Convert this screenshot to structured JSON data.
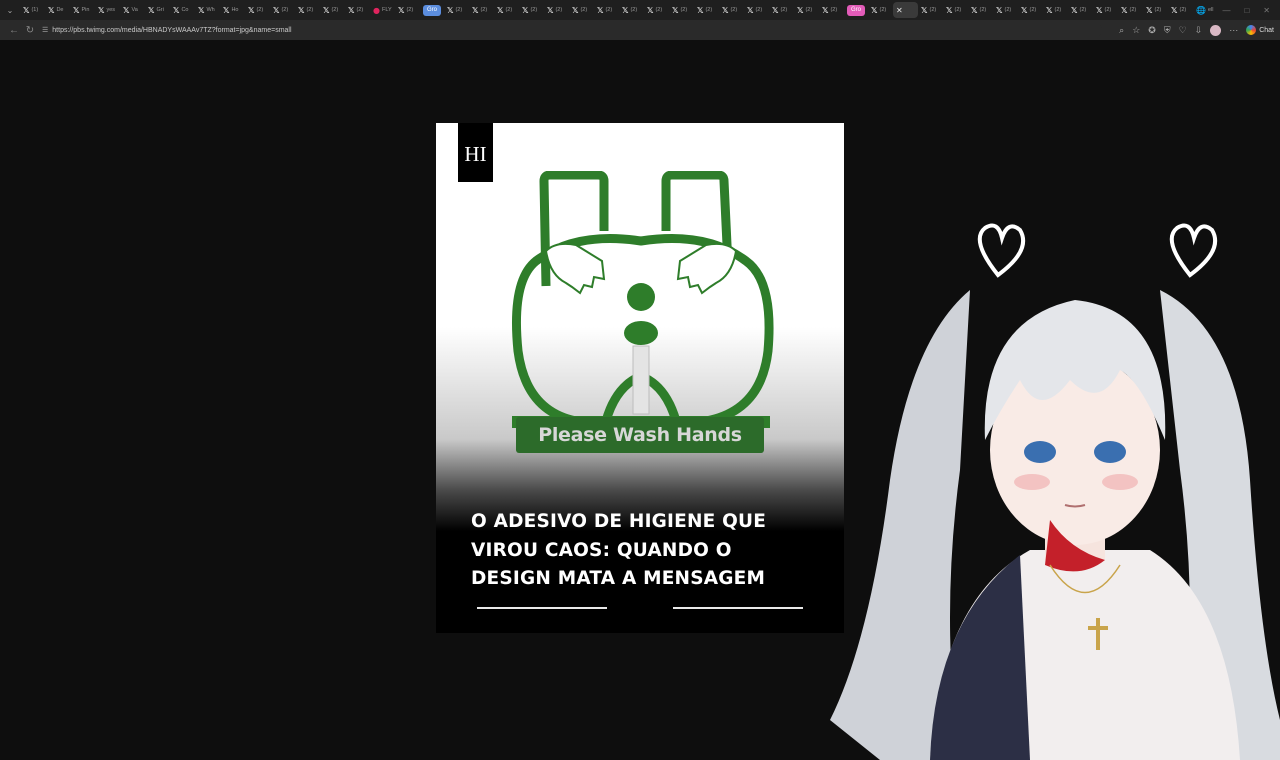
{
  "browser": {
    "tabs": [
      {
        "icon": "x-logo",
        "text": "(1)"
      },
      {
        "icon": "x-logo",
        "text": "De"
      },
      {
        "icon": "x-logo",
        "text": "Pin"
      },
      {
        "icon": "x-logo",
        "text": "yes"
      },
      {
        "icon": "x-logo",
        "text": "Va"
      },
      {
        "icon": "x-logo",
        "text": "Gri"
      },
      {
        "icon": "x-logo",
        "text": "Co"
      },
      {
        "icon": "x-logo",
        "text": "Wh"
      },
      {
        "icon": "x-logo",
        "text": "Ho"
      },
      {
        "icon": "x-logo",
        "text": "(2)"
      },
      {
        "icon": "x-logo",
        "text": "(2)"
      },
      {
        "icon": "x-logo",
        "text": "(2)"
      },
      {
        "icon": "x-logo",
        "text": "(2)"
      },
      {
        "icon": "x-logo",
        "text": "(2)"
      },
      {
        "icon": "red-dot",
        "text": "FLY"
      },
      {
        "icon": "x-logo",
        "text": "(2)"
      }
    ],
    "group_blue": "Gro",
    "tabs_after_blue": [
      {
        "icon": "x-logo",
        "text": "(2)"
      },
      {
        "icon": "x-logo",
        "text": "(2)"
      },
      {
        "icon": "x-logo",
        "text": "(2)"
      },
      {
        "icon": "x-logo",
        "text": "(2)"
      },
      {
        "icon": "x-logo",
        "text": "(2)"
      },
      {
        "icon": "x-logo",
        "text": "(2)"
      },
      {
        "icon": "x-logo",
        "text": "(2)"
      },
      {
        "icon": "x-logo",
        "text": "(2)"
      },
      {
        "icon": "x-logo",
        "text": "(2)"
      },
      {
        "icon": "x-logo",
        "text": "(2)"
      },
      {
        "icon": "x-logo",
        "text": "(2)"
      },
      {
        "icon": "x-logo",
        "text": "(2)"
      },
      {
        "icon": "x-logo",
        "text": "(2)"
      },
      {
        "icon": "x-logo",
        "text": "(2)"
      },
      {
        "icon": "x-logo",
        "text": "(2)"
      },
      {
        "icon": "x-logo",
        "text": "(2)"
      }
    ],
    "group_pink": "Gro",
    "tabs_after_pink": [
      {
        "icon": "x-logo",
        "text": "(2)"
      },
      {
        "icon": "close",
        "text": ""
      },
      {
        "icon": "x-logo",
        "text": "(2)"
      },
      {
        "icon": "x-logo",
        "text": "(2)"
      },
      {
        "icon": "x-logo",
        "text": "(2)"
      },
      {
        "icon": "x-logo",
        "text": "(2)"
      },
      {
        "icon": "x-logo",
        "text": "(2)"
      },
      {
        "icon": "x-logo",
        "text": "(2)"
      },
      {
        "icon": "x-logo",
        "text": "(2)"
      },
      {
        "icon": "x-logo",
        "text": "(2)"
      },
      {
        "icon": "x-logo",
        "text": "(2)"
      },
      {
        "icon": "x-logo",
        "text": "(2)"
      },
      {
        "icon": "x-logo",
        "text": "(2)"
      },
      {
        "icon": "globe",
        "text": "ell"
      }
    ],
    "url": "https://pbs.twimg.com/media/HBNADYsWAAAv7TZ?format=jpg&name=small",
    "chat_label": "Chat",
    "accent_blue": "#5b8dde",
    "accent_pink": "#e25bb8"
  },
  "image": {
    "brand": "HI",
    "sticker_text": "Please Wash Hands",
    "sticker_color": "#2e7d2a",
    "headline_lines": [
      "O ADESIVO DE HIGIENE QUE",
      "VIROU CAOS: QUANDO O",
      "DESIGN MATA A MENSAGEM"
    ]
  }
}
